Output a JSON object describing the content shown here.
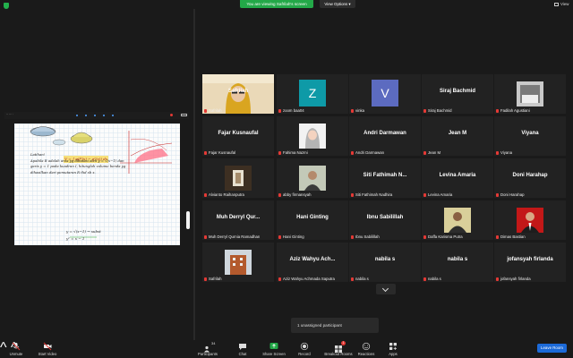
{
  "top": {
    "share_banner": "You are viewing Safrilah's screen",
    "view_options": "View Options",
    "view_label": "View"
  },
  "notebook": {
    "heading": "Latihan!",
    "line1": "Apabila R adalah area yg dibatasi oleh y = √(x−1) dan",
    "line2": "garis y = 1 pada kuadran I, hitunglah volume benda yg",
    "line3": "dihasilkan dari pemutaran R thd sb x.",
    "boxed_formula": "V = ∫ π(f²(x) − g²(x)) dx",
    "step1": "y = √(x−1) → subst",
    "step2": "y² = x − 1"
  },
  "participants": [
    {
      "name": "Safrilah",
      "tile_name": "Safrilah",
      "kind": "photo",
      "photo": "webcam-woman-hijab",
      "speaking": true
    },
    {
      "name": "zoom baa04",
      "tile_name": "",
      "kind": "avatar",
      "letter": "Z",
      "color": "#0e9aa7"
    },
    {
      "name": "vinka",
      "tile_name": "",
      "kind": "avatar",
      "letter": "V",
      "color": "#5c6bc0"
    },
    {
      "name": "Siraj Bachmid",
      "tile_name": "Siraj Bachmid",
      "kind": "text"
    },
    {
      "name": "Fadilah Agustiani",
      "tile_name": "",
      "kind": "photo",
      "photo": "profile-photo"
    },
    {
      "name": "Fajar Kusnaufal",
      "tile_name": "Fajar Kusnaufal",
      "kind": "text"
    },
    {
      "name": "Fahima Nazmi",
      "tile_name": "",
      "kind": "photo",
      "photo": "hijab-cartoon"
    },
    {
      "name": "Andri Darmawan",
      "tile_name": "Andri Darmawan",
      "kind": "text"
    },
    {
      "name": "Jean M",
      "tile_name": "Jean M",
      "kind": "text"
    },
    {
      "name": "Viyana",
      "tile_name": "Viyana",
      "kind": "text"
    },
    {
      "name": "Alvianto Raihanputra",
      "tile_name": "",
      "kind": "photo",
      "photo": "corridor"
    },
    {
      "name": "abby firmansyah",
      "tile_name": "",
      "kind": "photo",
      "photo": "person-photo"
    },
    {
      "name": "Siti Fathimah Nadhira",
      "tile_name": "Siti Fathimah N...",
      "kind": "text"
    },
    {
      "name": "Levina Amaria",
      "tile_name": "Levina Amaria",
      "kind": "text"
    },
    {
      "name": "Doni Harahap",
      "tile_name": "Doni Harahap",
      "kind": "text"
    },
    {
      "name": "Muh Derryl Qurnia Ramadhan",
      "tile_name": "Muh Derryl Qur...",
      "kind": "text"
    },
    {
      "name": "Hani Ginting",
      "tile_name": "Hani Ginting",
      "kind": "text"
    },
    {
      "name": "Ibnu Sabilillah",
      "tile_name": "Ibnu Sabilillah",
      "kind": "text"
    },
    {
      "name": "Daffa Karisma Putra",
      "tile_name": "",
      "kind": "photo",
      "photo": "man-photo"
    },
    {
      "name": "Dimas Bastian",
      "tile_name": "",
      "kind": "photo",
      "photo": "formal-portrait"
    },
    {
      "name": "Safrilah",
      "tile_name": "",
      "kind": "photo",
      "photo": "building"
    },
    {
      "name": "Aziz Wahyu Achmada Saputra",
      "tile_name": "Aziz Wahyu Ach...",
      "kind": "text"
    },
    {
      "name": "nabila s",
      "tile_name": "nabila s",
      "kind": "text"
    },
    {
      "name": "nabila s",
      "tile_name": "nabila s",
      "kind": "text"
    },
    {
      "name": "jofansyah firlanda",
      "tile_name": "jofansyah firlanda",
      "kind": "text"
    }
  ],
  "unassigned": "1 unassigned participant",
  "toolbar": {
    "unmute": "Unmute",
    "start_video": "Start Video",
    "participants": "Participants",
    "participants_count": "34",
    "chat": "Chat",
    "share_screen": "Share Screen",
    "record": "Record",
    "breakout_rooms": "Breakout Rooms",
    "breakout_badge": "1",
    "reactions": "Reactions",
    "apps": "Apps",
    "leave": "Leave Room"
  },
  "colors": {
    "accent": "#23a848",
    "leave": "#1c6ad8",
    "speaker": "#f0d000",
    "muted": "#e53935"
  }
}
